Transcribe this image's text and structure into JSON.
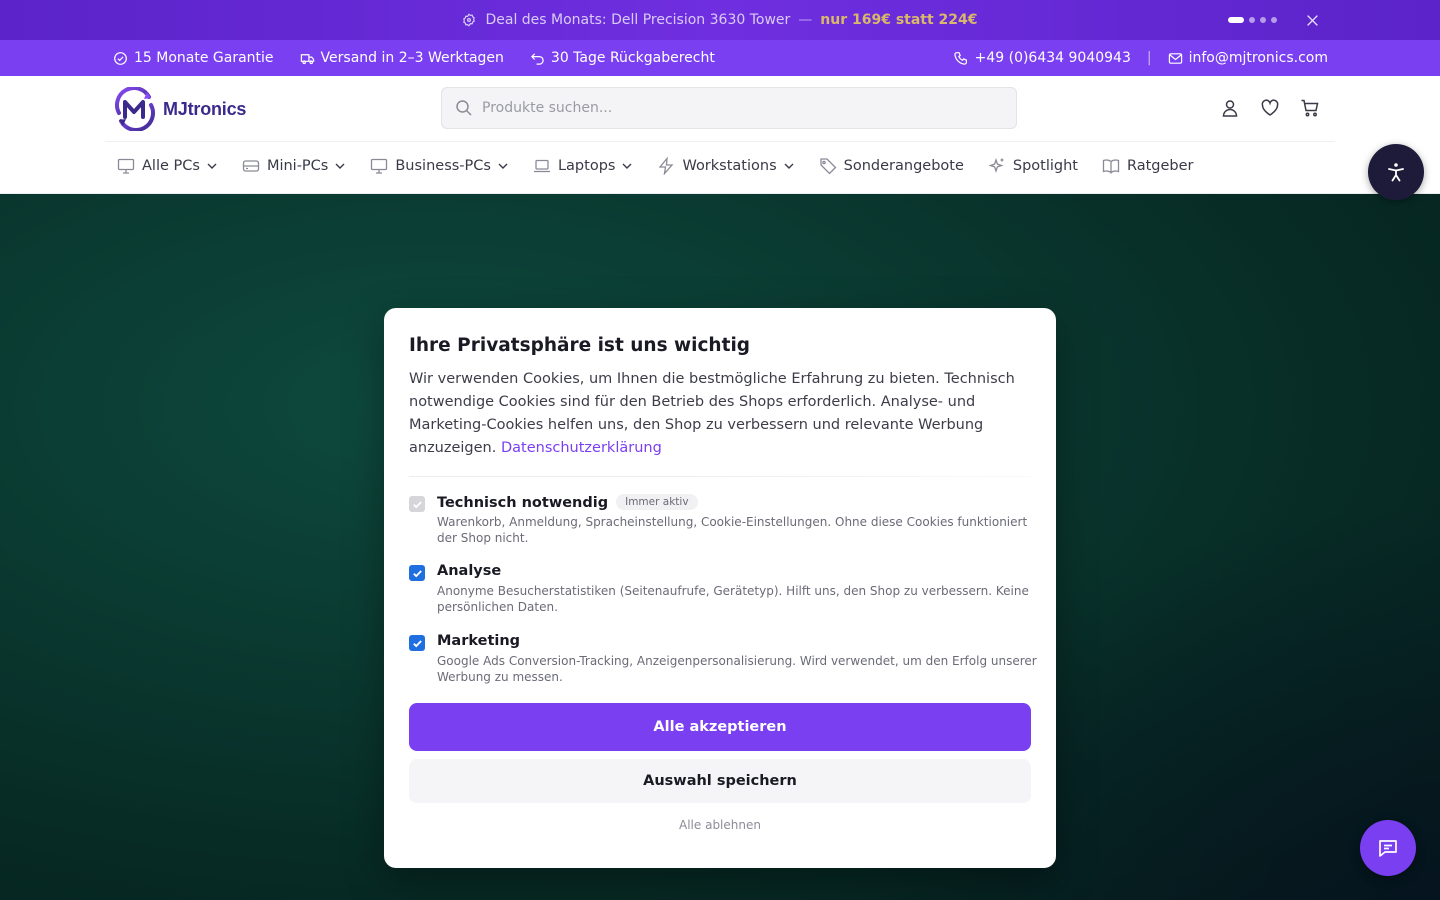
{
  "promo": {
    "text": "Deal des Monats: Dell Precision 3630 Tower",
    "separator": "—",
    "price": "nur 169€ statt 224€"
  },
  "infobar": {
    "warranty": "15 Monate Garantie",
    "shipping": "Versand in 2–3 Werktagen",
    "returns": "30 Tage Rückgaberecht",
    "phone": "+49 (0)6434 9040943",
    "separator": "|",
    "email": "info@mjtronics.com"
  },
  "header": {
    "logo_text": "MJtronics",
    "search_placeholder": "Produkte suchen..."
  },
  "nav": {
    "items": [
      {
        "label": "Alle PCs"
      },
      {
        "label": "Mini-PCs"
      },
      {
        "label": "Business-PCs"
      },
      {
        "label": "Laptops"
      },
      {
        "label": "Workstations"
      },
      {
        "label": "Sonderangebote"
      },
      {
        "label": "Spotlight"
      },
      {
        "label": "Ratgeber"
      }
    ]
  },
  "cookie_modal": {
    "title": "Ihre Privatsphäre ist uns wichtig",
    "intro": "Wir verwenden Cookies, um Ihnen die bestmögliche Erfahrung zu bieten. Technisch notwendige Cookies sind für den Betrieb des Shops erforderlich. Analyse- und Marketing-Cookies helfen uns, den Shop zu verbessern und relevante Werbung anzuzeigen.",
    "privacy_link": "Datenschutzerklärung",
    "options": [
      {
        "title": "Technisch notwendig",
        "badge": "Immer aktiv",
        "description": "Warenkorb, Anmeldung, Spracheinstellung, Cookie-Einstellungen. Ohne diese Cookies funktioniert der Shop nicht.",
        "checked": true,
        "disabled": true
      },
      {
        "title": "Analyse",
        "description": "Anonyme Besucherstatistiken (Seitenaufrufe, Gerätetyp). Hilft uns, den Shop zu verbessern. Keine persönlichen Daten.",
        "checked": true,
        "disabled": false
      },
      {
        "title": "Marketing",
        "description": "Google Ads Conversion-Tracking, Anzeigenpersonalisierung. Wird verwendet, um den Erfolg unserer Werbung zu messen.",
        "checked": true,
        "disabled": false
      }
    ],
    "accept_all": "Alle akzeptieren",
    "save_selection": "Auswahl speichern",
    "reject_all": "Alle ablehnen"
  },
  "colors": {
    "accent": "#7b3ff2",
    "promo_bg": "#5b23c9",
    "checkbox": "#1f6fe0",
    "hero_bg": "#0a3a31"
  }
}
